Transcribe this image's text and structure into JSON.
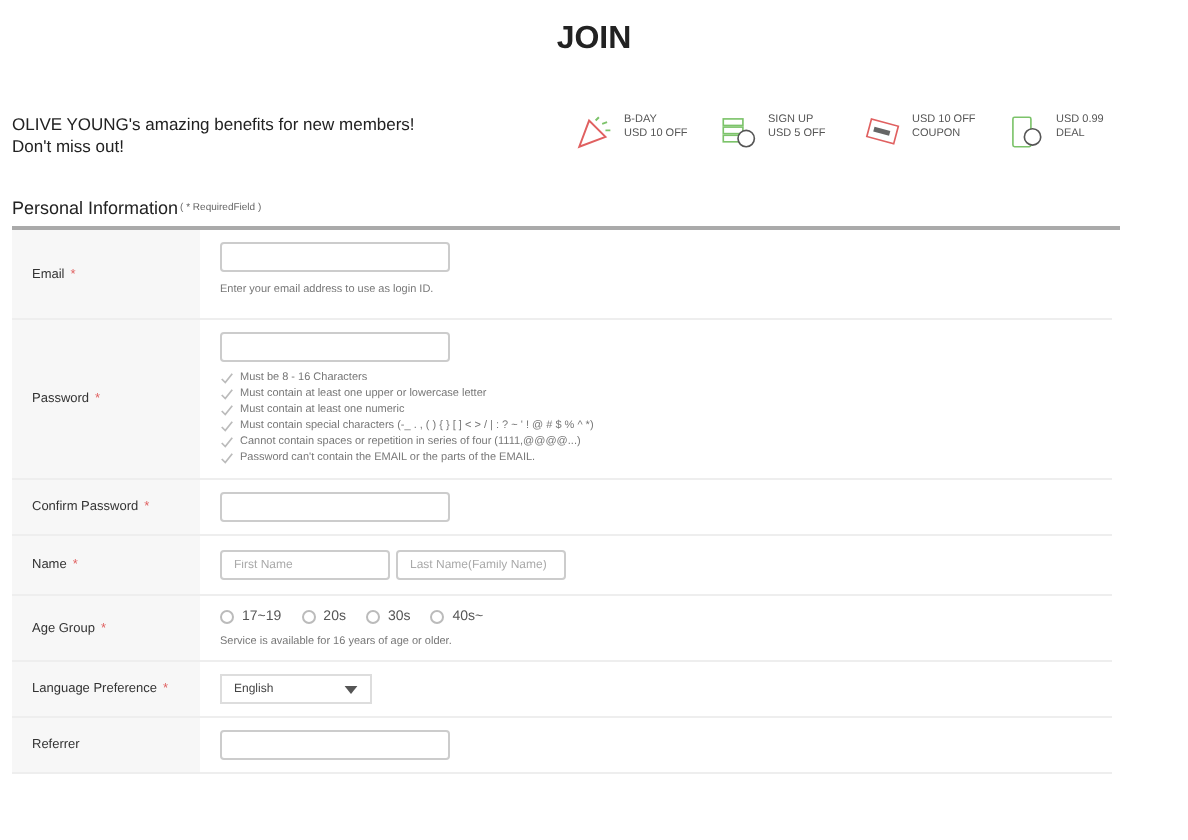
{
  "title": "JOIN",
  "benefits_intro": [
    "OLIVE YOUNG's amazing benefits for new members!",
    "Don't miss out!"
  ],
  "benefits": [
    {
      "lines": [
        "B-DAY",
        "USD 10 OFF"
      ]
    },
    {
      "lines": [
        "SIGN UP",
        "USD 5 OFF"
      ]
    },
    {
      "lines": [
        "USD 10 OFF",
        "COUPON"
      ]
    },
    {
      "lines": [
        "USD 0.99",
        "DEAL"
      ]
    }
  ],
  "section": {
    "title": "Personal Information",
    "note": "( * RequiredField )"
  },
  "fields": [
    {
      "kind": "text",
      "label": "Email",
      "required": "*",
      "hint": "Enter your email address to use as login ID."
    },
    {
      "kind": "rules",
      "label": "Password",
      "required": "*",
      "rules": [
        "Must be 8 - 16 Characters",
        "Must contain at least one upper or lowercase letter",
        "Must contain at least one numeric",
        "Must contain special characters (-_ . , ( ) { } [ ] < > / | : ? ~ ' ! @ # $ % ^ *)",
        "Cannot contain spaces or repetition in series of four (1111,@@@@...)",
        "Password can't contain the EMAIL or the parts of the EMAIL."
      ]
    },
    {
      "kind": "text",
      "label": "Confirm Password",
      "required": "*"
    },
    {
      "kind": "name",
      "label": "Name",
      "required": "*",
      "placeholders": [
        "First Name",
        "Last Name(Family Name)"
      ]
    },
    {
      "kind": "radio",
      "label": "Age Group",
      "required": "*",
      "options": [
        {
          "label": "17~19",
          "selected": false
        },
        {
          "label": "20s",
          "selected": false
        },
        {
          "label": "30s",
          "selected": false
        },
        {
          "label": "40s~",
          "selected": false
        }
      ],
      "hint": "Service is available for 16 years of age or older."
    },
    {
      "kind": "select",
      "label": "Language Preference",
      "required": "*",
      "value": "English"
    },
    {
      "kind": "text",
      "label": "Referrer"
    }
  ]
}
